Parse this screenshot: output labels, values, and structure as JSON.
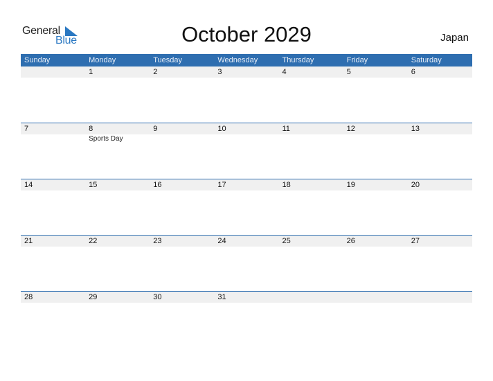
{
  "logo": {
    "word1": "General",
    "word2": "Blue",
    "icon": "triangle-flag-icon"
  },
  "title": "October 2029",
  "country": "Japan",
  "colors": {
    "header": "#2e6eb0",
    "date_strip": "#f0f0f0",
    "brand_blue": "#2a78c2"
  },
  "weekdays": [
    "Sunday",
    "Monday",
    "Tuesday",
    "Wednesday",
    "Thursday",
    "Friday",
    "Saturday"
  ],
  "weeks": [
    {
      "days": [
        "",
        "1",
        "2",
        "3",
        "4",
        "5",
        "6"
      ],
      "events": [
        "",
        "",
        "",
        "",
        "",
        "",
        ""
      ]
    },
    {
      "days": [
        "7",
        "8",
        "9",
        "10",
        "11",
        "12",
        "13"
      ],
      "events": [
        "",
        "Sports Day",
        "",
        "",
        "",
        "",
        ""
      ]
    },
    {
      "days": [
        "14",
        "15",
        "16",
        "17",
        "18",
        "19",
        "20"
      ],
      "events": [
        "",
        "",
        "",
        "",
        "",
        "",
        ""
      ]
    },
    {
      "days": [
        "21",
        "22",
        "23",
        "24",
        "25",
        "26",
        "27"
      ],
      "events": [
        "",
        "",
        "",
        "",
        "",
        "",
        ""
      ]
    },
    {
      "days": [
        "28",
        "29",
        "30",
        "31",
        "",
        "",
        ""
      ],
      "events": [
        "",
        "",
        "",
        "",
        "",
        "",
        ""
      ]
    }
  ]
}
